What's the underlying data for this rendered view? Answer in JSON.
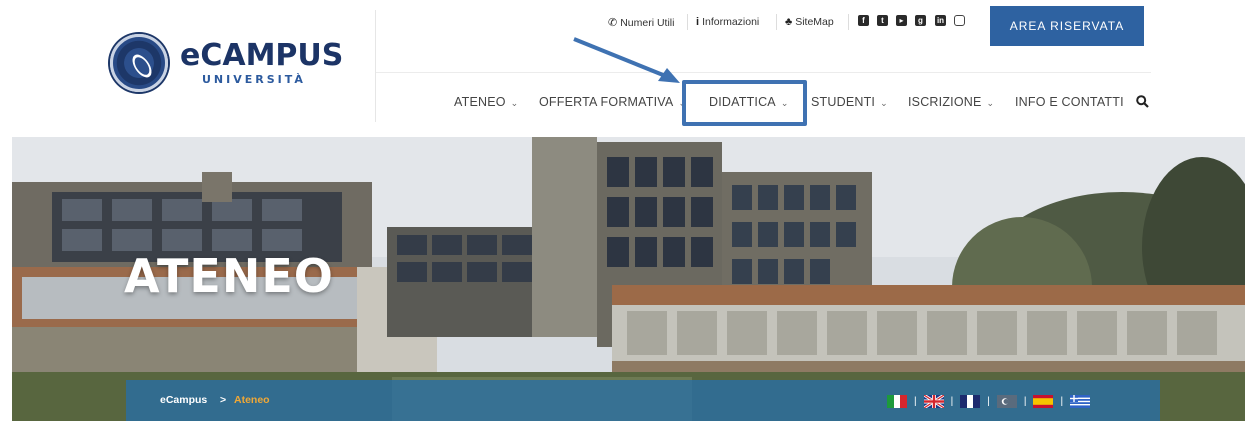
{
  "logo": {
    "main": "eCAMPUS",
    "sub": "UNIVERSITÀ"
  },
  "topbar": {
    "numeri": {
      "icon": "phone-icon",
      "label": "Numeri Utili"
    },
    "info": {
      "icon": "info-icon",
      "label": "Informazioni"
    },
    "sitemap": {
      "icon": "sitemap-icon",
      "label": "SiteMap"
    },
    "social": [
      "facebook-icon",
      "twitter-icon",
      "youtube-icon",
      "google-plus-icon",
      "linkedin-icon",
      "instagram-icon"
    ],
    "area_button": "AREA RISERVATA"
  },
  "nav": {
    "items": [
      {
        "label": "ATENEO",
        "caret": "⌄"
      },
      {
        "label": "OFFERTA FORMATIVA",
        "caret": "⌄"
      },
      {
        "label": "DIDATTICA",
        "caret": "⌄"
      },
      {
        "label": "STUDENTI",
        "caret": "⌄"
      },
      {
        "label": "ISCRIZIONE",
        "caret": "⌄"
      },
      {
        "label": "INFO E CONTATTI",
        "caret": ""
      }
    ],
    "search_icon": "search-icon",
    "highlighted": "DIDATTICA"
  },
  "hero": {
    "title": "ATENEO",
    "breadcrumb": {
      "home": "eCampus",
      "separator": ">",
      "current": "Ateneo"
    },
    "flags": [
      "it",
      "en",
      "fr",
      "tr",
      "es",
      "gr"
    ]
  },
  "colors": {
    "brand_blue": "#2e62a1",
    "logo_navy": "#1c3466",
    "breadcrumb_current": "#f0a836",
    "annotation": "#3f72b2"
  }
}
